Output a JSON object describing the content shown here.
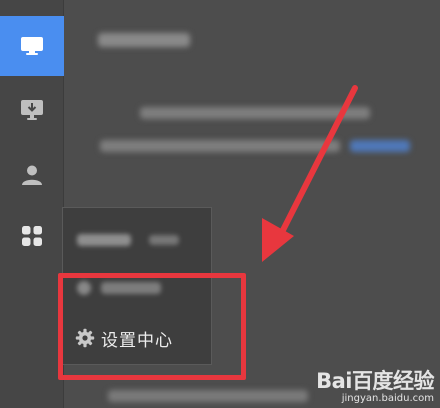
{
  "sidebar": {
    "items": [
      {
        "icon": "monitor-icon",
        "active": true
      },
      {
        "icon": "download-monitor-icon",
        "active": false
      },
      {
        "icon": "user-icon",
        "active": false
      },
      {
        "icon": "apps-grid-icon",
        "active": false
      }
    ]
  },
  "popup": {
    "settings_label": "设置中心",
    "settings_icon": "gear-icon"
  },
  "annotation": {
    "color": "#e8373e"
  },
  "watermark": {
    "logo_text": "Bai百度经验",
    "url": "jingyan.baidu.com"
  },
  "colors": {
    "active_nav": "#4a8ef0",
    "background": "#4d4d4d",
    "popup_bg": "#3e3e3e"
  }
}
